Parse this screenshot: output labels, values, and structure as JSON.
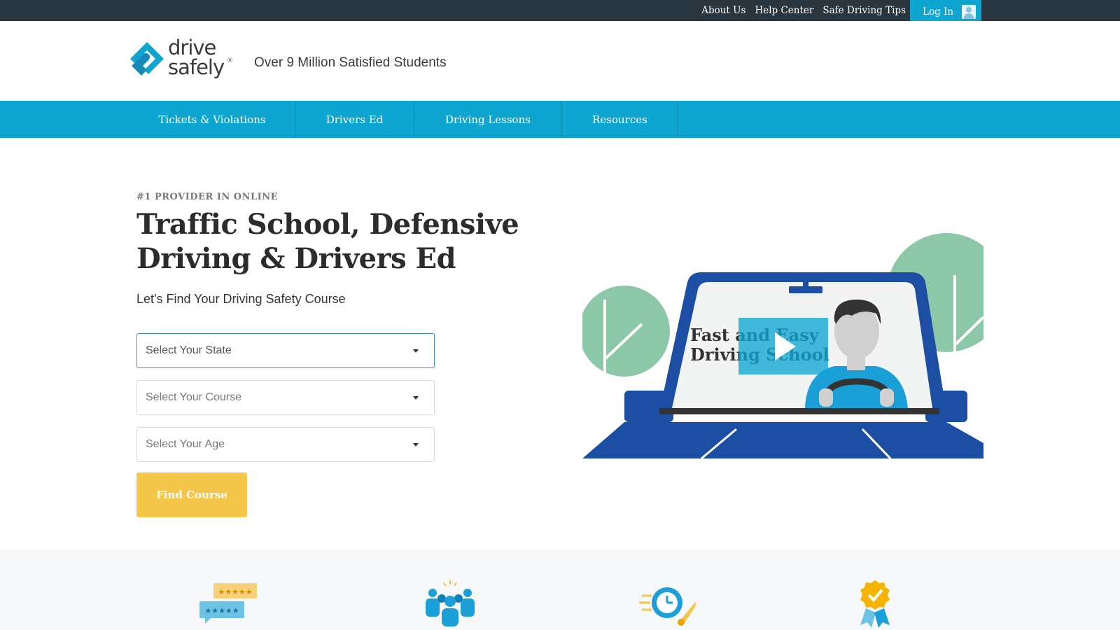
{
  "topbar": {
    "links": [
      "About Us",
      "Help Center",
      "Safe Driving Tips"
    ],
    "login_label": "Log In"
  },
  "header": {
    "logo_word1": "drive",
    "logo_word2": "safely",
    "logo_reg": "®",
    "tagline": "Over 9 Million Satisfied Students"
  },
  "nav": {
    "items": [
      "Tickets & Violations",
      "Drivers Ed",
      "Driving Lessons",
      "Resources"
    ]
  },
  "hero": {
    "eyebrow": "#1 PROVIDER IN ONLINE",
    "headline": "Traffic School, Defensive Driving & Drivers Ed",
    "subhead": "Let's Find Your Driving Safety Course",
    "state_select": "Select Your State",
    "course_select": "Select Your Course",
    "age_select": "Select Your Age",
    "find_button": "Find Course"
  },
  "video": {
    "line1": "Fast and Easy",
    "line2": "Driving School"
  },
  "colors": {
    "topbar": "#293640",
    "brand_blue": "#0fa5d1",
    "button_yellow": "#f4c64a",
    "car_blue": "#1c4fa3",
    "tree_green": "#8cc7a7"
  },
  "icons": [
    "reviews-icon",
    "students-icon",
    "fast-rocket-icon",
    "award-badge-icon"
  ]
}
